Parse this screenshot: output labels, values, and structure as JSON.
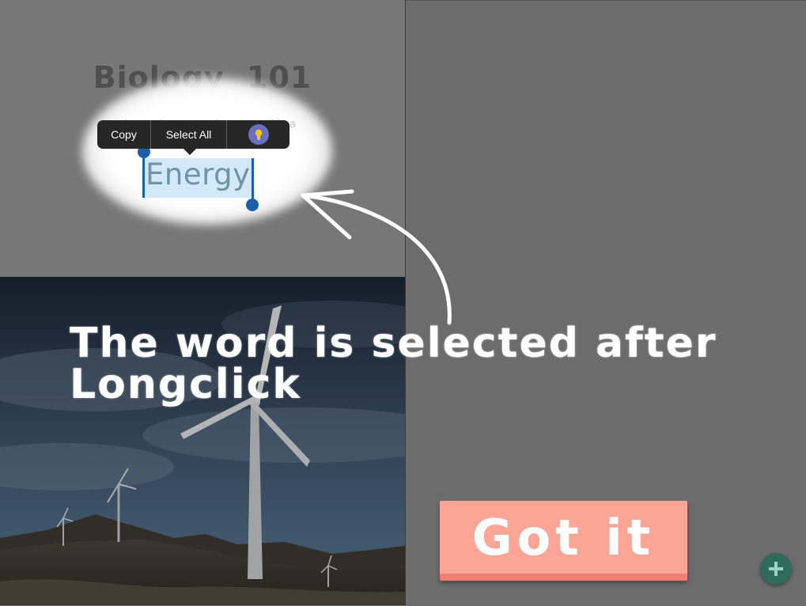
{
  "document": {
    "title": "Biology 101",
    "body_text": "species such as mussels, water mil boatman"
  },
  "context_menu": {
    "copy_label": "Copy",
    "select_all_label": "Select All",
    "idea_icon": "lightbulb-icon"
  },
  "selection": {
    "word": "Energy"
  },
  "tutorial": {
    "caption": "The word is selected after Longclick",
    "dismiss_label": "Got it"
  },
  "fab": {
    "icon": "plus-icon"
  },
  "colors": {
    "got_it_bg": "#fba597",
    "selection_handle": "#1b5fa8",
    "selection_highlight": "#d3e8f8",
    "fab": "#2e6b5a"
  }
}
